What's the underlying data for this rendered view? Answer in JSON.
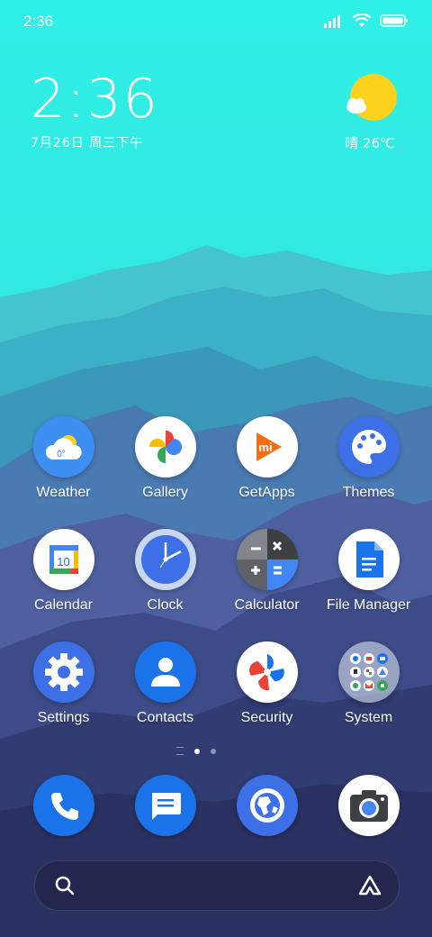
{
  "status_bar": {
    "time": "2:36"
  },
  "clock_widget": {
    "time": "2:36",
    "date": "7月26日 周三下午"
  },
  "weather_widget": {
    "text": "晴 26℃"
  },
  "apps": [
    {
      "label": "Weather"
    },
    {
      "label": "Gallery"
    },
    {
      "label": "GetApps"
    },
    {
      "label": "Themes"
    },
    {
      "label": "Calendar"
    },
    {
      "label": "Clock"
    },
    {
      "label": "Calculator"
    },
    {
      "label": "File Manager"
    },
    {
      "label": "Settings"
    },
    {
      "label": "Contacts"
    },
    {
      "label": "Security"
    },
    {
      "label": "System"
    }
  ],
  "icon_text": {
    "weather_temp": "0°",
    "calendar_day": "10"
  },
  "dock": [
    "Phone",
    "Messages",
    "Browser",
    "Camera"
  ],
  "page_indicator": {
    "pages": 2,
    "active": 1
  },
  "colors": {
    "sky": "#2fe8e0",
    "accent_blue": "#1a73e8"
  }
}
